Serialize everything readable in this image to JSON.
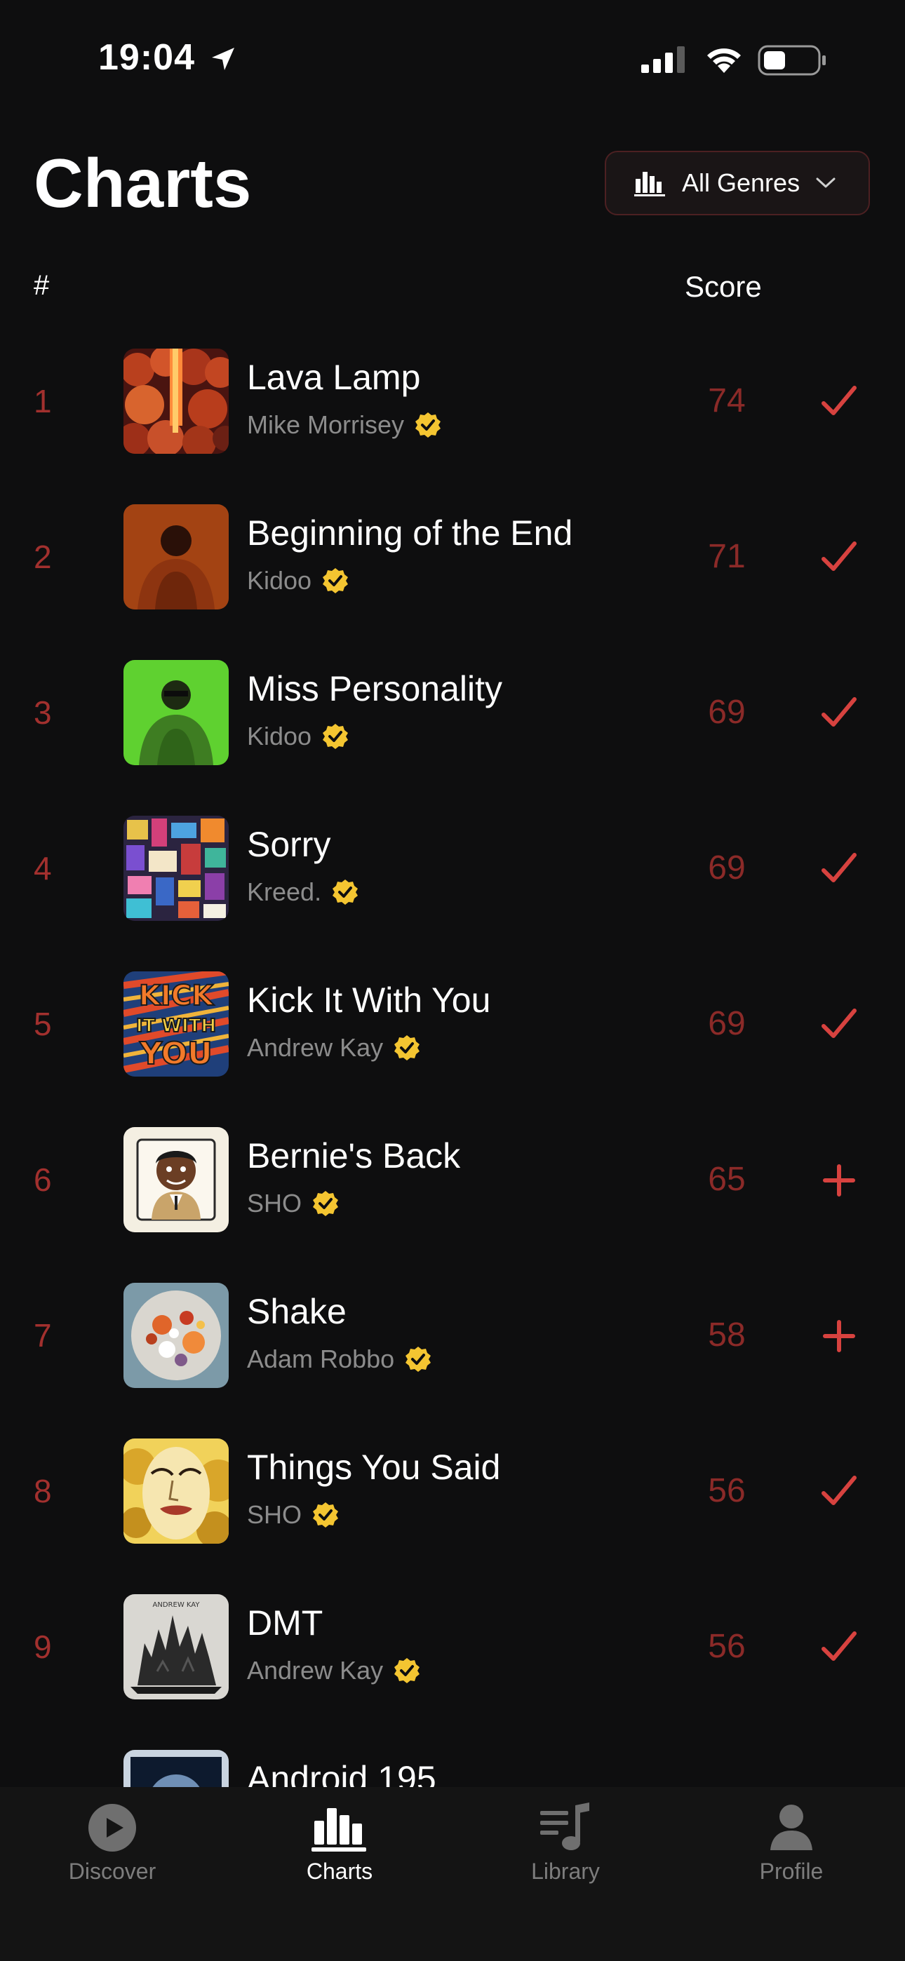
{
  "status": {
    "time": "19:04"
  },
  "header": {
    "title": "Charts",
    "genre_label": "All Genres"
  },
  "columns": {
    "rank": "#",
    "score": "Score"
  },
  "tracks": [
    {
      "rank": "1",
      "title": "Lava Lamp",
      "artist": "Mike Morrisey",
      "score": "74",
      "action": "check",
      "art": "lava"
    },
    {
      "rank": "2",
      "title": "Beginning of the End",
      "artist": "Kidoo",
      "score": "71",
      "action": "check",
      "art": "orange-person"
    },
    {
      "rank": "3",
      "title": "Miss Personality",
      "artist": "Kidoo",
      "score": "69",
      "action": "check",
      "art": "green-person"
    },
    {
      "rank": "4",
      "title": "Sorry",
      "artist": "Kreed.",
      "score": "69",
      "action": "check",
      "art": "collage"
    },
    {
      "rank": "5",
      "title": "Kick It With You",
      "artist": "Andrew Kay",
      "score": "69",
      "action": "check",
      "art": "kick-text"
    },
    {
      "rank": "6",
      "title": "Bernie's Back",
      "artist": "SHO",
      "score": "65",
      "action": "add",
      "art": "cartoon-man"
    },
    {
      "rank": "7",
      "title": "Shake",
      "artist": "Adam Robbo",
      "score": "58",
      "action": "add",
      "art": "circle-splash"
    },
    {
      "rank": "8",
      "title": "Things You Said",
      "artist": "SHO",
      "score": "56",
      "action": "check",
      "art": "face-comic"
    },
    {
      "rank": "9",
      "title": "DMT",
      "artist": "Andrew Kay",
      "score": "56",
      "action": "check",
      "art": "castle"
    },
    {
      "rank": "",
      "title": "Android 195",
      "artist": "",
      "score": "",
      "action": "",
      "art": "space"
    }
  ],
  "art_labels": {
    "kick": [
      "KICK",
      "IT WITH",
      "YOU"
    ],
    "castle": "ANDREW KAY"
  },
  "tabs": [
    {
      "label": "Discover",
      "icon": "play-circle-icon",
      "active": false
    },
    {
      "label": "Charts",
      "icon": "bar-chart-icon",
      "active": true
    },
    {
      "label": "Library",
      "icon": "music-list-icon",
      "active": false
    },
    {
      "label": "Profile",
      "icon": "person-icon",
      "active": false
    }
  ],
  "colors": {
    "background": "#0e0e0f",
    "accent": "#d7423f",
    "rank": "#a2302e",
    "score": "#8b2a28",
    "verified": "#f4c531",
    "muted": "#8c8c8c"
  }
}
